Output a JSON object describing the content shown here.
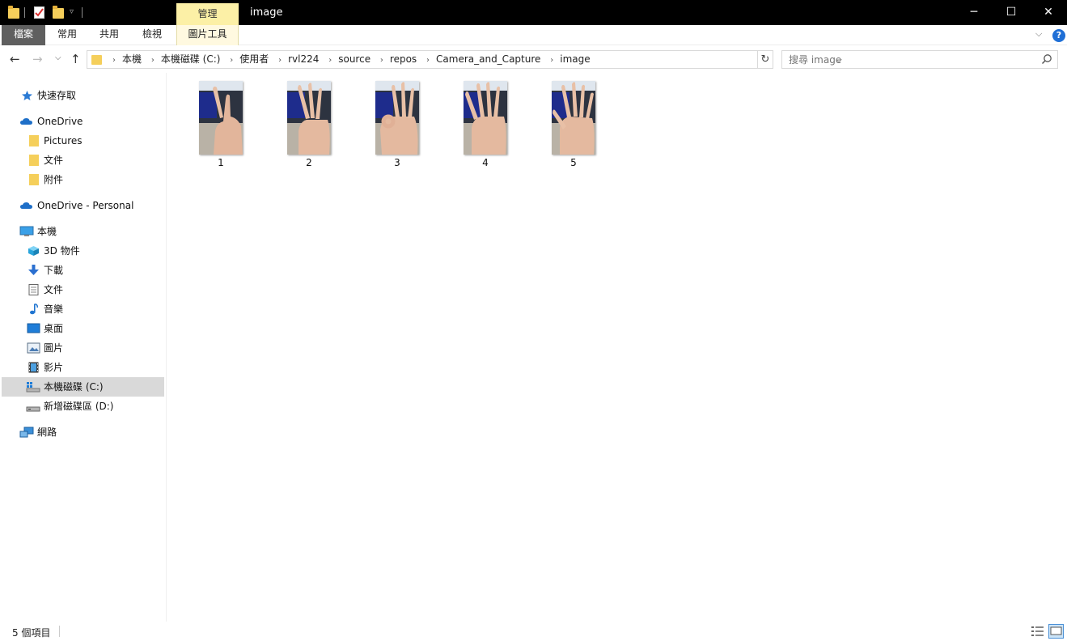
{
  "window": {
    "title": "image",
    "context_tab": "管理",
    "controls": {
      "minimize": "─",
      "maximize": "☐",
      "close": "✕"
    }
  },
  "ribbon": {
    "tabs": [
      "檔案",
      "常用",
      "共用",
      "檢視",
      "圖片工具"
    ],
    "collapse": "⌵",
    "help": "?"
  },
  "address": {
    "crumbs": [
      "本機",
      "本機磁碟 (C:)",
      "使用者",
      "rvl224",
      "source",
      "repos",
      "Camera_and_Capture",
      "image"
    ],
    "separator": "›",
    "dropdown": "⌵",
    "refresh": "↻"
  },
  "nav_buttons": {
    "back": "←",
    "forward": "→",
    "recent": "⌵",
    "up": "↑"
  },
  "search": {
    "placeholder": "搜尋 image",
    "value": ""
  },
  "nav_pane": {
    "quick_access": "快速存取",
    "onedrive": "OneDrive",
    "onedrive_items": [
      "Pictures",
      "文件",
      "附件"
    ],
    "onedrive_personal": "OneDrive - Personal",
    "this_pc": "本機",
    "this_pc_items": [
      "3D 物件",
      "下載",
      "文件",
      "音樂",
      "桌面",
      "圖片",
      "影片",
      "本機磁碟 (C:)",
      "新增磁碟區 (D:)"
    ],
    "network": "網路",
    "selected": "本機磁碟 (C:)"
  },
  "files": [
    {
      "name": "1"
    },
    {
      "name": "2"
    },
    {
      "name": "3"
    },
    {
      "name": "4"
    },
    {
      "name": "5"
    }
  ],
  "status": {
    "count_text": "5 個項目"
  },
  "colors": {
    "titlebar": "#000000",
    "context_tab": "#fcf0a6",
    "file_tab": "#5f5f5f",
    "selection": "#d9d9d9",
    "accent": "#1f6fd6"
  }
}
